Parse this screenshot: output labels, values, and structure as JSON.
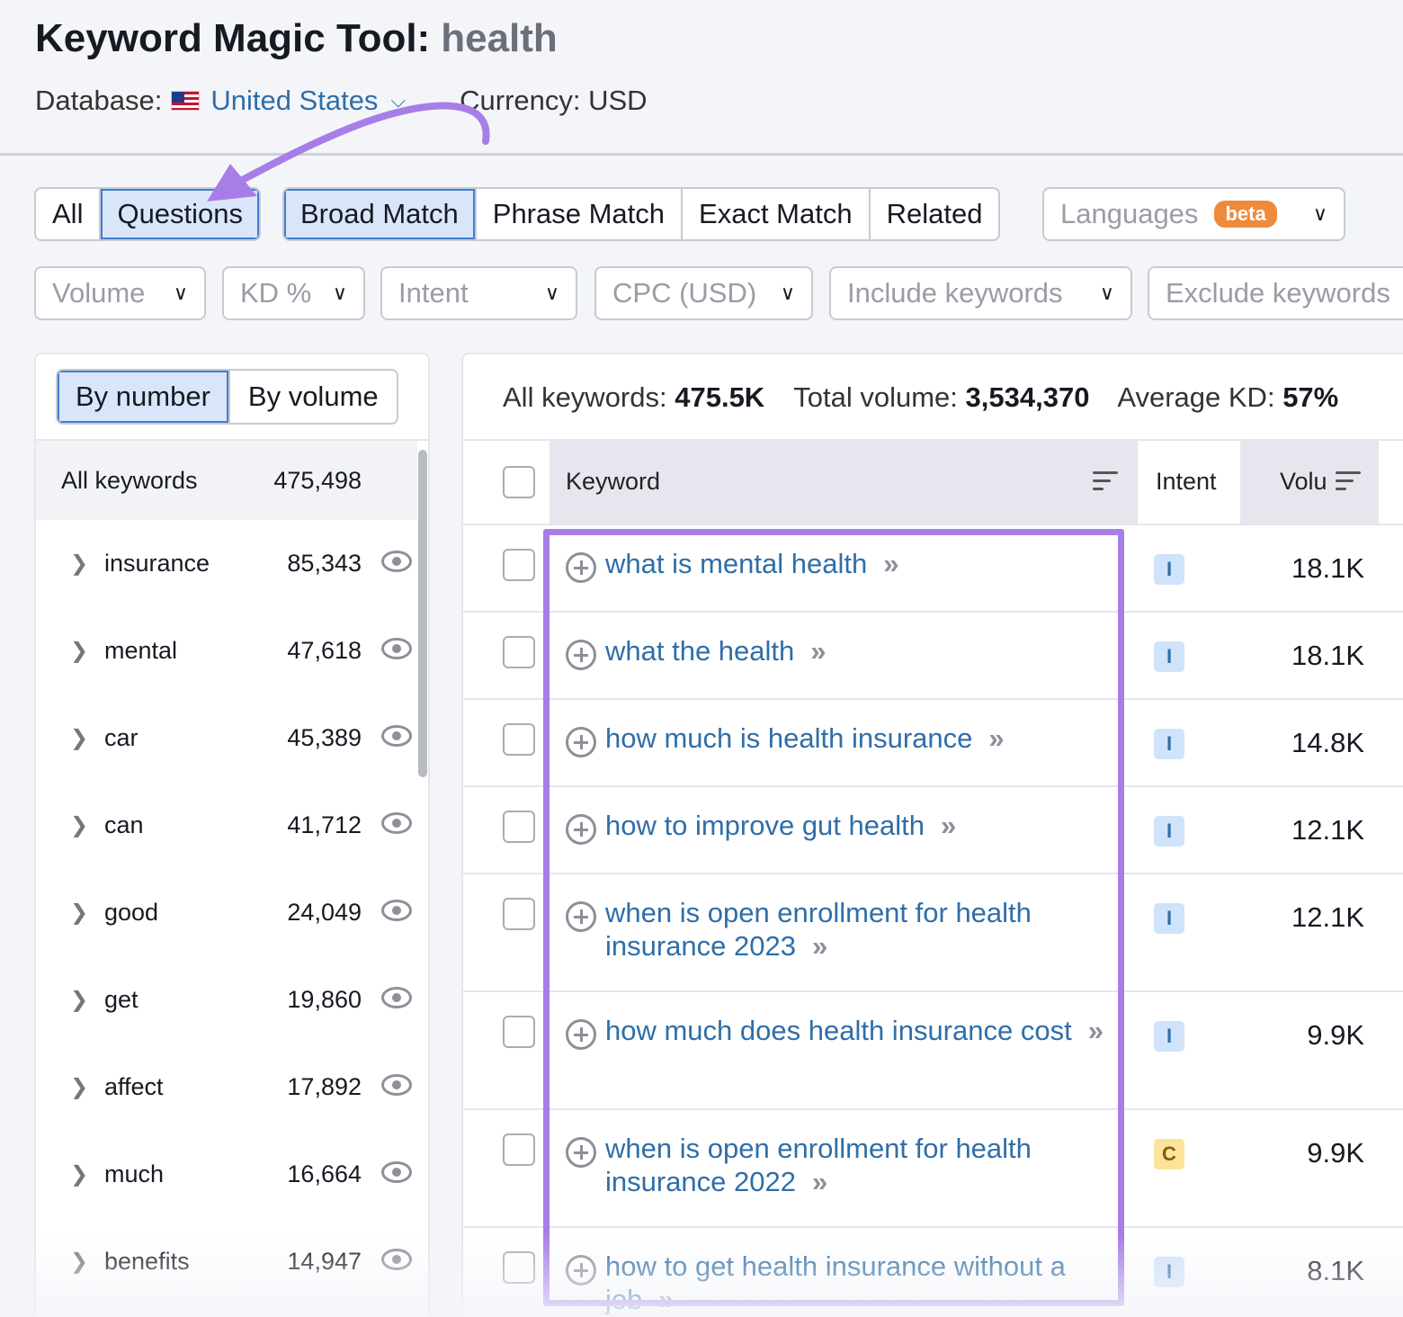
{
  "header": {
    "title": "Keyword Magic Tool:",
    "query": "health",
    "database_label": "Database:",
    "database_value": "United States",
    "currency": "Currency: USD"
  },
  "match_tabs": {
    "first": [
      {
        "label": "All",
        "active": false
      },
      {
        "label": "Questions",
        "active": true
      }
    ],
    "second": [
      {
        "label": "Broad Match",
        "active": true
      },
      {
        "label": "Phrase Match",
        "active": false
      },
      {
        "label": "Exact Match",
        "active": false
      },
      {
        "label": "Related",
        "active": false
      }
    ],
    "languages": {
      "label": "Languages",
      "badge": "beta"
    }
  },
  "filters": [
    "Volume",
    "KD %",
    "Intent",
    "CPC (USD)",
    "Include keywords",
    "Exclude keywords"
  ],
  "left_panel": {
    "toggle": [
      {
        "label": "By number",
        "active": true
      },
      {
        "label": "By volume",
        "active": false
      }
    ],
    "all": {
      "label": "All keywords",
      "count": "475,498"
    },
    "groups": [
      {
        "label": "insurance",
        "count": "85,343"
      },
      {
        "label": "mental",
        "count": "47,618"
      },
      {
        "label": "car",
        "count": "45,389"
      },
      {
        "label": "can",
        "count": "41,712"
      },
      {
        "label": "good",
        "count": "24,049"
      },
      {
        "label": "get",
        "count": "19,860"
      },
      {
        "label": "affect",
        "count": "17,892"
      },
      {
        "label": "much",
        "count": "16,664"
      },
      {
        "label": "benefits",
        "count": "14,947"
      }
    ]
  },
  "stats": {
    "all_label": "All keywords:",
    "all_value": "475.5K",
    "vol_label": "Total volume:",
    "vol_value": "3,534,370",
    "kd_label": "Average KD:",
    "kd_value": "57%"
  },
  "table": {
    "headers": {
      "keyword": "Keyword",
      "intent": "Intent",
      "volume": "Volu"
    },
    "rows": [
      {
        "keyword": "what is mental health",
        "intent": "I",
        "volume": "18.1K"
      },
      {
        "keyword": "what the health",
        "intent": "I",
        "volume": "18.1K"
      },
      {
        "keyword": "how much is health insurance",
        "intent": "I",
        "volume": "14.8K"
      },
      {
        "keyword": "how to improve gut health",
        "intent": "I",
        "volume": "12.1K"
      },
      {
        "keyword": "when is open enrollment for health insurance 2023",
        "intent": "I",
        "volume": "12.1K"
      },
      {
        "keyword": "how much does health insurance cost",
        "intent": "I",
        "volume": "9.9K"
      },
      {
        "keyword": "when is open enrollment for health insurance 2022",
        "intent": "C",
        "volume": "9.9K"
      },
      {
        "keyword": "how to get health insurance without a job",
        "intent": "I",
        "volume": "8.1K"
      }
    ]
  },
  "colors": {
    "link": "#2f6ea8",
    "active_bg": "#d9e6fa",
    "highlight": "#a77ee8",
    "intent_i_bg": "#cfe3fb",
    "intent_i_fg": "#2f6ea8",
    "intent_c_bg": "#fbe39a",
    "intent_c_fg": "#8a5a00"
  },
  "icons": {
    "arrows": "»",
    "chevron": "chevron-down-icon",
    "eye": "eye-icon",
    "plus": "plus-circle-icon"
  }
}
